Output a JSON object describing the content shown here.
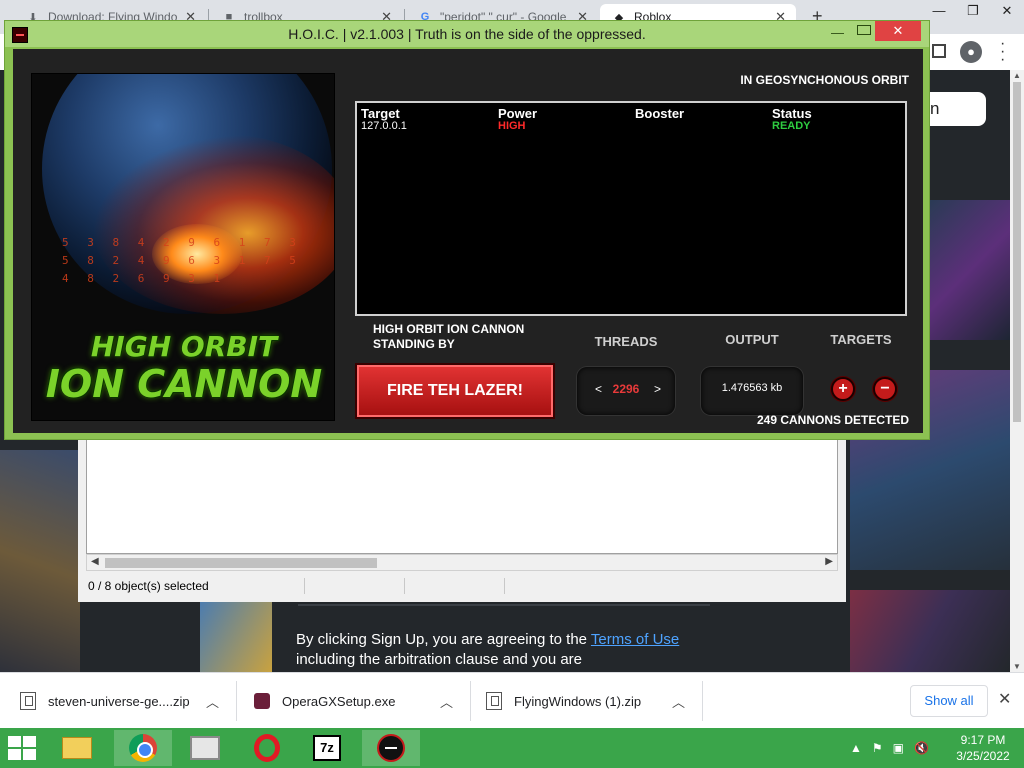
{
  "browser": {
    "tabs": [
      {
        "label": "Download: Flying Windo",
        "icon": "download-icon"
      },
      {
        "label": "trollbox",
        "icon": "trollbox-icon"
      },
      {
        "label": "\"peridot\" \" cur\" - Google",
        "icon": "google-icon"
      },
      {
        "label": "Roblox",
        "icon": "roblox-icon"
      }
    ],
    "new_tab": "+",
    "window_controls": {
      "minimize": "—",
      "restore": "❐",
      "close": "✕"
    }
  },
  "page": {
    "login_partial": "n",
    "signup_prefix": "By clicking Sign Up, you are agreeing to the ",
    "terms_link": "Terms of Use",
    "signup_suffix": " including the arbitration clause and you are"
  },
  "explorer": {
    "status": "0 / 8 object(s) selected"
  },
  "hoic": {
    "title": "H.O.I.C. | v2.1.003 | Truth is on the side of the oppressed.",
    "orbit_status": "IN GEOSYNCHONOUS ORBIT",
    "poster": {
      "line1": "HIGH ORBIT",
      "line2": "ION CANNON",
      "numbers": "5 3 8 4 2 9 6 1 7 3 5 8 2 4 9 6 3 1 7 5 4 8 2 6 9 3 1"
    },
    "table": {
      "headers": [
        "Target",
        "Power",
        "Booster",
        "Status"
      ],
      "rows": [
        {
          "target": "127.0.0.1",
          "power": "HIGH",
          "booster": "",
          "status": "READY"
        }
      ]
    },
    "status_line1": "HIGH ORBIT ION CANNON",
    "status_line2": "STANDING BY",
    "fire_label": "FIRE TEH LAZER!",
    "threads_label": "THREADS",
    "threads_value": "2296",
    "threads_dec": "<",
    "threads_inc": ">",
    "output_label": "OUTPUT",
    "output_value": "1.476563 kb",
    "targets_label": "TARGETS",
    "add_target": "+",
    "remove_target": "−",
    "cannons": "249 CANNONS DETECTED"
  },
  "downloads": {
    "items": [
      {
        "name": "steven-universe-ge....zip",
        "type": "zip"
      },
      {
        "name": "OperaGXSetup.exe",
        "type": "exe"
      },
      {
        "name": "FlyingWindows (1).zip",
        "type": "zip"
      }
    ],
    "show_all": "Show all",
    "close": "✕"
  },
  "taskbar": {
    "apps": [
      "file-explorer-icon",
      "chrome-icon",
      "system-monitor-icon",
      "opera-icon",
      "7zip-icon",
      "hoic-icon"
    ],
    "seven_zip_label": "7z",
    "clock_time": "9:17 PM",
    "clock_date": "3/25/2022",
    "tray_arrow": "▲"
  },
  "colors": {
    "hoic_frame": "#8cc152",
    "hoic_body": "#222222",
    "fire_button": "#c41b1b",
    "power_high": "#ff2a2a",
    "status_ready": "#2ecc40",
    "taskbar": "#3aa54a"
  }
}
